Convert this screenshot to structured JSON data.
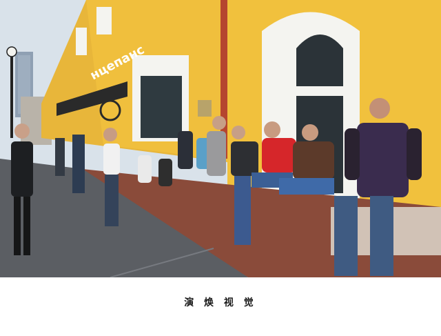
{
  "photo": {
    "subject": "street-scene",
    "storefront_sign": "нцепанс",
    "colors": {
      "building_wall": "#f1c13d",
      "window_frame": "#f4f4f0",
      "pavement": "#5b5e63",
      "sky": "#d9e2ea",
      "plinth": "#8a4b3a"
    }
  },
  "caption": {
    "text": "演 焕 视 觉"
  }
}
